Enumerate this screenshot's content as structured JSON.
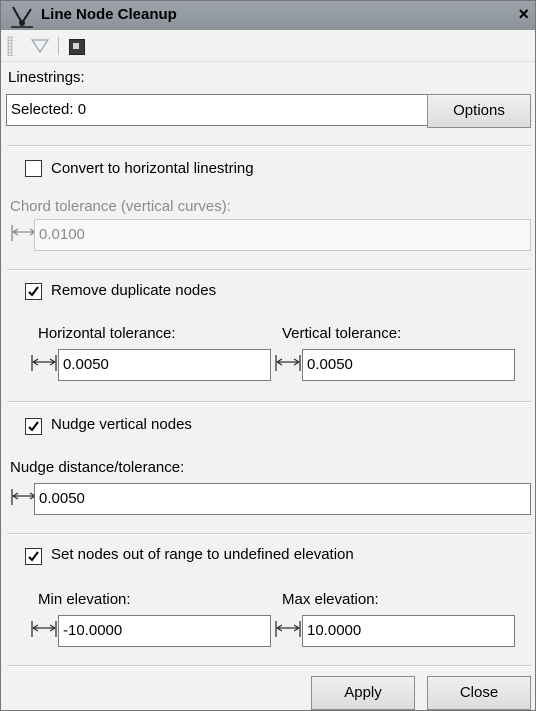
{
  "window": {
    "title": "Line Node Cleanup",
    "close_label": "×",
    "icons": [
      "line-node-icon",
      "filter-icon",
      "image-icon",
      "close-icon"
    ]
  },
  "linestrings": {
    "label": "Linestrings:",
    "value": "Selected: 0",
    "options_label": "Options"
  },
  "convert": {
    "label": "Convert to horizontal linestring",
    "checked": false,
    "chord_label": "Chord tolerance (vertical curves):",
    "chord_value": "0.0100"
  },
  "duplicate": {
    "label": "Remove duplicate nodes",
    "checked": true,
    "h_label": "Horizontal tolerance:",
    "h_value": "0.0050",
    "v_label": "Vertical tolerance:",
    "v_value": "0.0050"
  },
  "nudge": {
    "label": "Nudge vertical nodes",
    "checked": true,
    "dist_label": "Nudge distance/tolerance:",
    "dist_value": "0.0050"
  },
  "range": {
    "label": "Set nodes out of range to undefined elevation",
    "checked": true,
    "min_label": "Min elevation:",
    "min_value": "-10.0000",
    "max_label": "Max elevation:",
    "max_value": "10.0000"
  },
  "footer": {
    "apply_label": "Apply",
    "close_label": "Close"
  }
}
